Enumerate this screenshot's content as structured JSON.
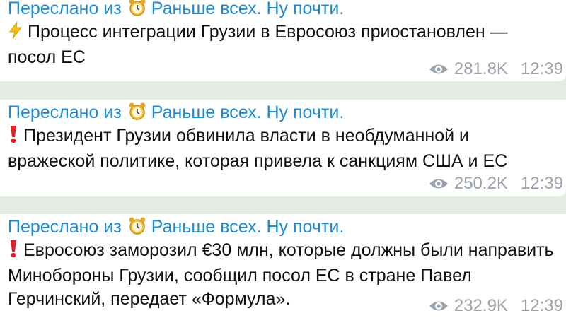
{
  "messages": [
    {
      "forwarded_prefix": "Переслано из",
      "channel": "Раньше всех. Ну почти.",
      "icon": "lightning-icon",
      "text": "Процесс интеграции Грузии в Евросоюз приостановлен — посол ЕС",
      "views": "281.8K",
      "time": "12:39"
    },
    {
      "forwarded_prefix": "Переслано из",
      "channel": "Раньше всех. Ну почти.",
      "icon": "exclamation-icon",
      "text": "Президент Грузии обвинила власти в необдуманной и вражеской политике, которая привела к санкциям США и ЕС",
      "views": "250.2K",
      "time": "12:39"
    },
    {
      "forwarded_prefix": "Переслано из",
      "channel": "Раньше всех. Ну почти.",
      "icon": "exclamation-icon",
      "text": "Евросоюз заморозил €30 млн, которые должны были направить Минобороны Грузии, сообщил посол ЕС в стране Павел Герчинский, передает «Формула».",
      "views": "232.9K",
      "time": "12:39"
    }
  ],
  "colors": {
    "link": "#1d8bd1",
    "meta": "#9aa3ad",
    "background": "#e4ebe3",
    "bubble": "#ffffff"
  }
}
